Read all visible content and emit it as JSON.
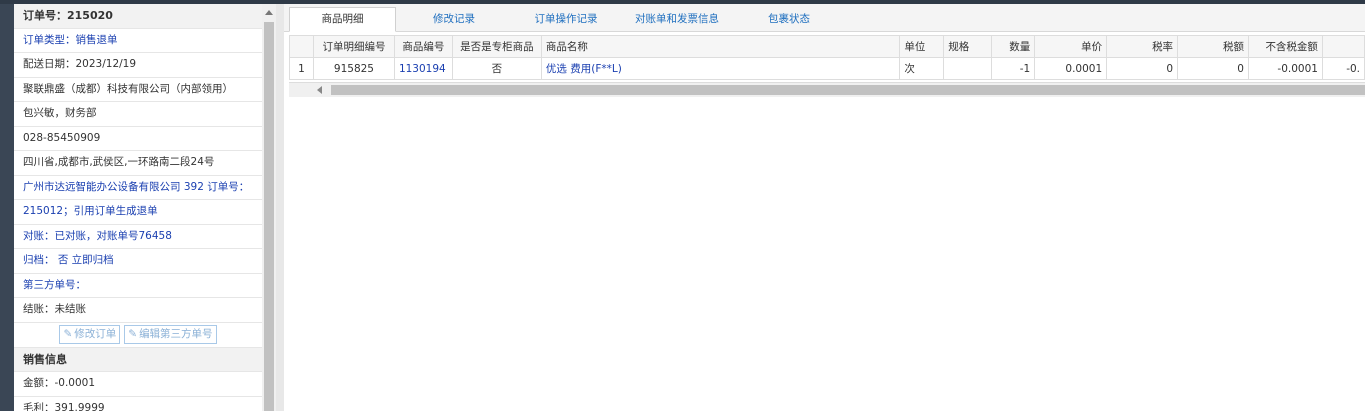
{
  "order": {
    "title": "订单号：215020",
    "details": [
      {
        "text": "订单类型：销售退单",
        "blue": true
      },
      {
        "text": "配送日期：2023/12/19",
        "blue": false
      },
      {
        "text": "聚联鼎盛（成都）科技有限公司（内部领用）",
        "blue": false
      },
      {
        "text": "包兴敏，财务部",
        "blue": false
      },
      {
        "text": "028-85450909",
        "blue": false
      },
      {
        "text": "四川省,成都市,武侯区,一环路南二段24号",
        "blue": false
      },
      {
        "text": "广州市达远智能办公设备有限公司 392 订单号：",
        "blue": true
      },
      {
        "text": "215012；引用订单生成退单",
        "blue": true
      },
      {
        "text": "对账：已对账，对账单号76458",
        "blue": true
      },
      {
        "text": "归档： 否 立即归档",
        "blue": true
      },
      {
        "text": "第三方单号：",
        "blue": true
      },
      {
        "text": "结账：未结账",
        "blue": false
      }
    ],
    "edit_order_label": "修改订单",
    "edit_third_party_label": "编辑第三方单号"
  },
  "sales": {
    "title": "销售信息",
    "amount": "金额：-0.0001",
    "profit": "毛利：391.9999"
  },
  "tabs": [
    "商品明细",
    "修改记录",
    "订单操作记录",
    "对账单和发票信息",
    "包裹状态"
  ],
  "active_tab": 0,
  "grid": {
    "headers": [
      "订单明细编号",
      "商品编号",
      "是否是专柜商品",
      "商品名称",
      "单位",
      "规格",
      "数量",
      "单价",
      "税率",
      "税额",
      "不含税金额",
      ""
    ],
    "rows": [
      {
        "index": "1",
        "detail_no": "915825",
        "product_no": "1130194",
        "is_counter": "否",
        "name": "优选 费用(F**L)",
        "unit": "次",
        "spec": "",
        "qty": "-1",
        "price": "0.0001",
        "tax_rate": "0",
        "tax": "0",
        "net_amount": "-0.0001",
        "extra": "-0."
      }
    ]
  },
  "colors": {
    "accent_blue": "#1a3fb0",
    "tab_blue": "#1f6fbf",
    "sidebar_dark": "#3a4655"
  }
}
